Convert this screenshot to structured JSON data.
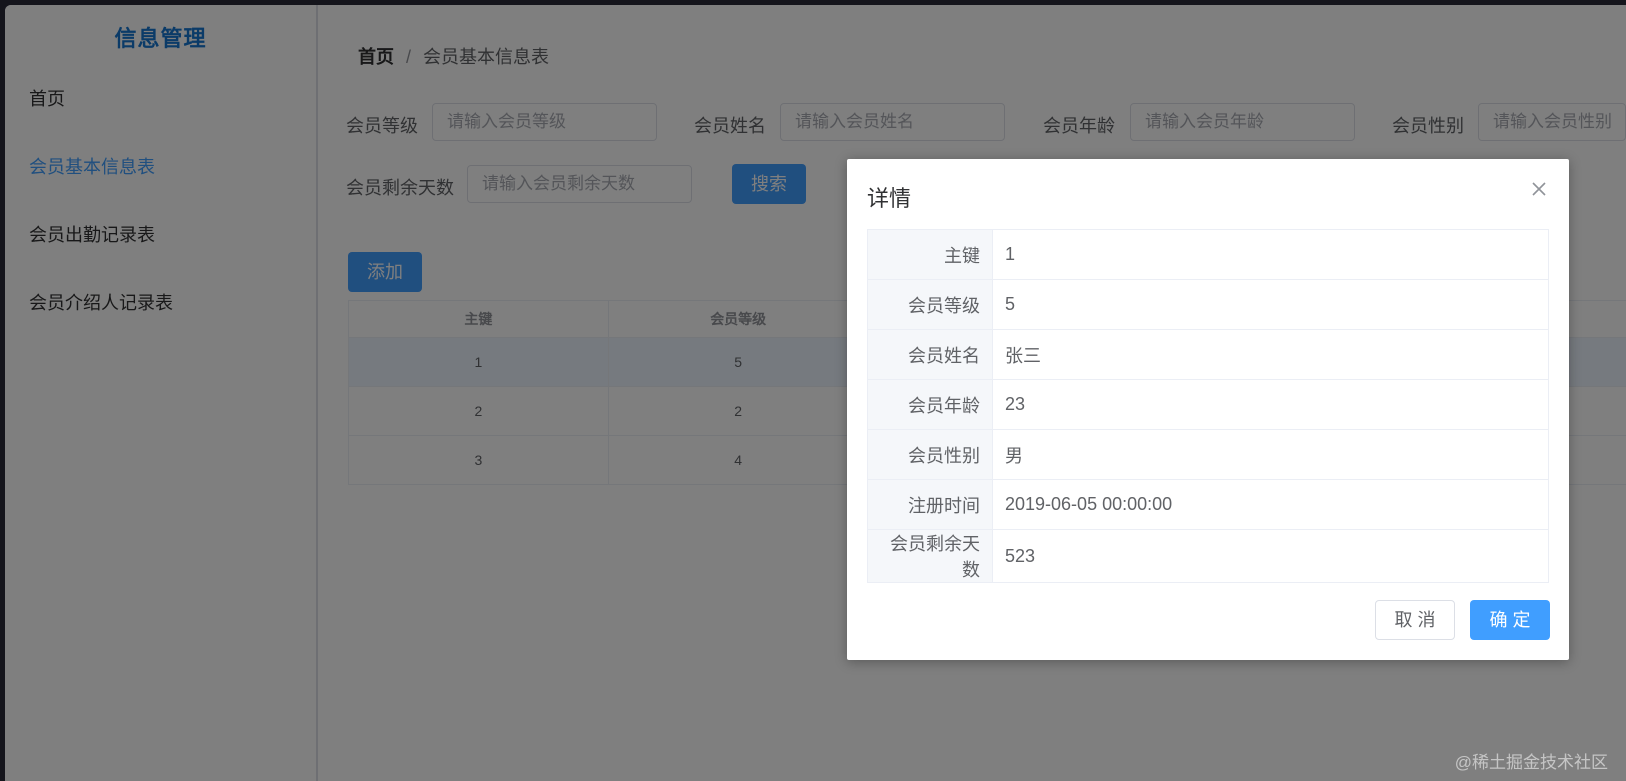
{
  "sidebar": {
    "brand": "信息管理",
    "items": [
      {
        "label": "首页"
      },
      {
        "label": "会员基本信息表"
      },
      {
        "label": "会员出勤记录表"
      },
      {
        "label": "会员介绍人记录表"
      }
    ]
  },
  "breadcrumb": {
    "home": "首页",
    "separator": "/",
    "current": "会员基本信息表"
  },
  "filters": [
    {
      "label": "会员等级",
      "placeholder": "请输入会员等级"
    },
    {
      "label": "会员姓名",
      "placeholder": "请输入会员姓名"
    },
    {
      "label": "会员年龄",
      "placeholder": "请输入会员年龄"
    },
    {
      "label": "会员性别",
      "placeholder": "请输入会员性别"
    },
    {
      "label": "会员剩余天数",
      "placeholder": "请输入会员剩余天数"
    }
  ],
  "search_label": "搜索",
  "add_label": "添加",
  "table": {
    "columns": [
      "主键",
      "会员等级"
    ],
    "rows": [
      [
        "1",
        "5"
      ],
      [
        "2",
        "2"
      ],
      [
        "3",
        "4"
      ]
    ]
  },
  "dialog": {
    "title": "详情",
    "fields": [
      {
        "key": "主键",
        "value": "1"
      },
      {
        "key": "会员等级",
        "value": "5"
      },
      {
        "key": "会员姓名",
        "value": "张三"
      },
      {
        "key": "会员年龄",
        "value": "23"
      },
      {
        "key": "会员性别",
        "value": "男"
      },
      {
        "key": "注册时间",
        "value": "2019-06-05 00:00:00"
      },
      {
        "key": "会员剩余天数",
        "value": "523"
      }
    ],
    "cancel_label": "取 消",
    "ok_label": "确 定"
  },
  "watermark": "@稀土掘金技术社区"
}
